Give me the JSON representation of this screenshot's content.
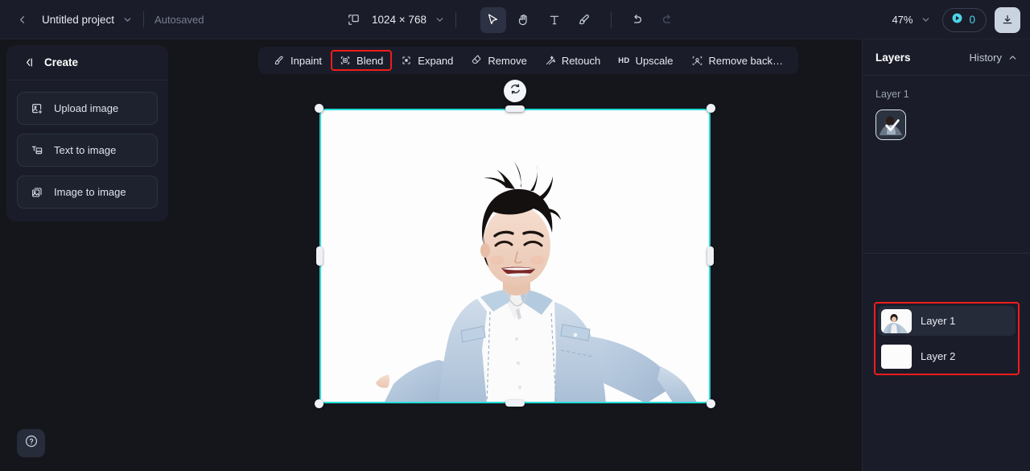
{
  "topbar": {
    "back_icon": "chevron-left-icon",
    "project_name": "Untitled project",
    "project_dropdown_icon": "chevron-down-icon",
    "autosaved_label": "Autosaved",
    "canvas_size_icon": "canvas-resize-icon",
    "canvas_size_label": "1024 × 768",
    "canvas_size_dropdown_icon": "chevron-down-icon",
    "tools": [
      {
        "name": "select-tool",
        "icon": "cursor-arrow-icon",
        "active": true
      },
      {
        "name": "hand-tool",
        "icon": "hand-icon",
        "active": false
      },
      {
        "name": "text-tool",
        "icon": "text-t-icon",
        "active": false
      },
      {
        "name": "brush-tool",
        "icon": "brush-icon",
        "active": false
      }
    ],
    "undo": {
      "name": "undo-button",
      "icon": "undo-arrow-icon",
      "enabled": true
    },
    "redo": {
      "name": "redo-button",
      "icon": "redo-arrow-icon",
      "enabled": false
    },
    "zoom_level": "47%",
    "zoom_dropdown_icon": "chevron-down-icon",
    "credits_icon": "credit-coin-icon",
    "credits_count": "0",
    "download_icon": "download-icon"
  },
  "create_panel": {
    "collapse_icon": "collapse-left-icon",
    "title": "Create",
    "items": [
      {
        "label": "Upload image",
        "icon": "upload-image-icon"
      },
      {
        "label": "Text to image",
        "icon": "text-to-image-icon"
      },
      {
        "label": "Image to image",
        "icon": "image-to-image-icon"
      }
    ]
  },
  "help": {
    "icon": "question-mark-icon",
    "label": "?"
  },
  "edit_toolbar": {
    "items": [
      {
        "label": "Inpaint",
        "icon": "inpaint-brush-icon",
        "highlighted": false
      },
      {
        "label": "Blend",
        "icon": "blend-icon",
        "highlighted": true
      },
      {
        "label": "Expand",
        "icon": "expand-frame-icon",
        "highlighted": false
      },
      {
        "label": "Remove",
        "icon": "eraser-icon",
        "highlighted": false
      },
      {
        "label": "Retouch",
        "icon": "retouch-wand-icon",
        "highlighted": false
      },
      {
        "label": "Upscale",
        "icon": "hd-badge-icon",
        "badge": "HD",
        "highlighted": false
      },
      {
        "label": "Remove back…",
        "icon": "remove-background-icon",
        "highlighted": false
      }
    ]
  },
  "canvas": {
    "rotate_icon": "rotate-icon",
    "selection_color": "#24dbd6",
    "artboard_background": "#fdfdfd",
    "content_description": "smiling young man in light blue denim jacket on white background"
  },
  "layers_panel": {
    "title": "Layers",
    "history_label": "History",
    "history_icon": "chevron-up-icon",
    "active_layer_label": "Layer 1",
    "selected_thumb_badge": "check-icon",
    "layers": [
      {
        "name": "Layer 1",
        "thumb": "portrait-thumb",
        "selected": true
      },
      {
        "name": "Layer 2",
        "thumb": "blank-white-thumb",
        "selected": false
      }
    ],
    "highlight_color": "#f01c1c"
  }
}
